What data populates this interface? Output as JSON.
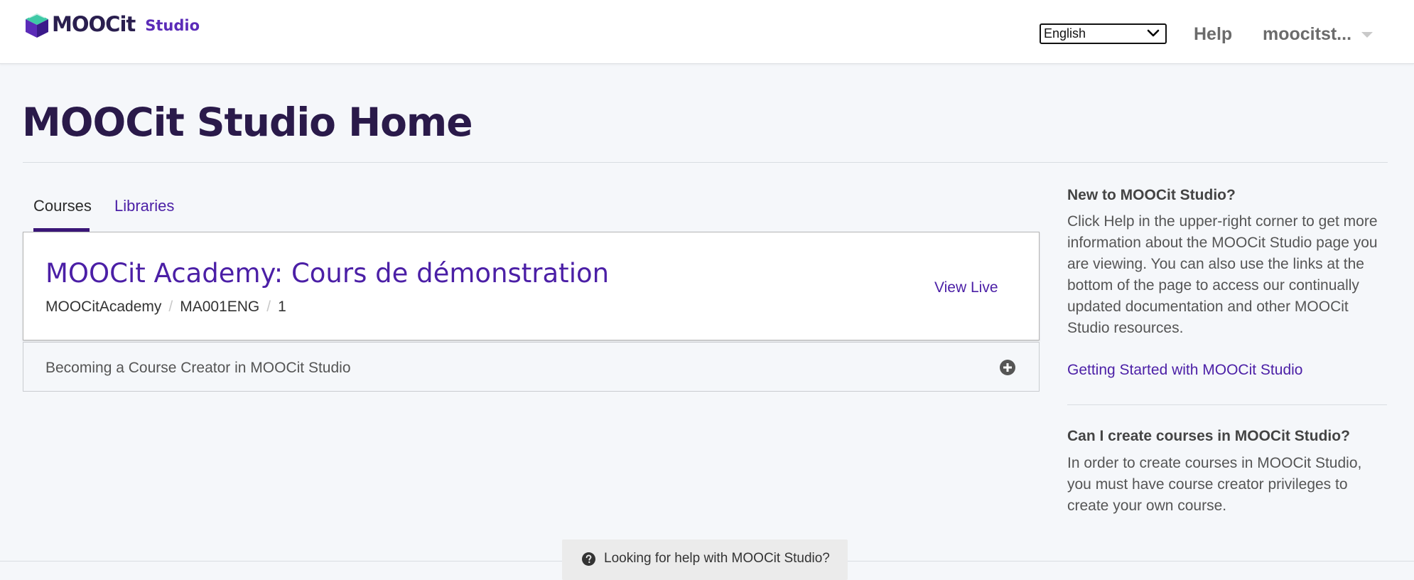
{
  "header": {
    "logo_text": "MOOCit",
    "logo_sub": "Studio",
    "language": {
      "selected": "English",
      "options": [
        "English"
      ]
    },
    "help_label": "Help",
    "user_label": "moocitst..."
  },
  "page": {
    "title": "MOOCit Studio Home"
  },
  "tabs": [
    {
      "label": "Courses",
      "active": true
    },
    {
      "label": "Libraries",
      "active": false
    }
  ],
  "course": {
    "title": "MOOCit Academy: Cours de démonstration",
    "org": "MOOCitAcademy",
    "number": "MA001ENG",
    "run": "1",
    "separator": "/",
    "view_live_label": "View Live"
  },
  "creator": {
    "label": "Becoming a Course Creator in MOOCit Studio"
  },
  "sidebar": {
    "new_heading": "New to MOOCit Studio?",
    "new_text": "Click Help in the upper-right corner to get more information about the MOOCit Studio page you are viewing. You can also use the links at the bottom of the page to access our continually updated documentation and other MOOCit Studio resources.",
    "getting_started_link": "Getting Started with MOOCit Studio",
    "create_heading": "Can I create courses in MOOCit Studio?",
    "create_text": "In order to create courses in MOOCit Studio, you must have course creator privileges to create your own course."
  },
  "footer": {
    "help_text": "Looking for help with MOOCit Studio?"
  },
  "colors": {
    "accent": "#4b1fa6",
    "title": "#2a1a4a",
    "background": "#f5f7fa"
  }
}
